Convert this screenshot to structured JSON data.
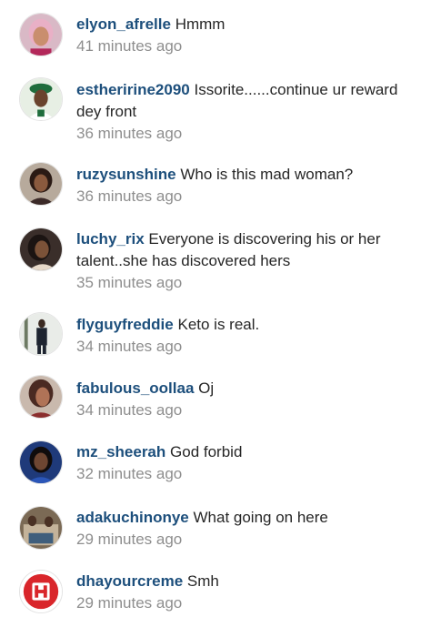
{
  "comments": [
    {
      "username": "elyon_afrelle",
      "text": "Hmmm",
      "time": "41 minutes ago",
      "avatar_icon": "avatar-woman-pink-hair-icon"
    },
    {
      "username": "estheririne2090",
      "text": "Issorite......continue ur reward dey front",
      "time": "36 minutes ago",
      "avatar_icon": "avatar-woman-cap-icon"
    },
    {
      "username": "ruzysunshine",
      "text": "Who is this mad woman?",
      "time": "36 minutes ago",
      "avatar_icon": "avatar-woman-icon"
    },
    {
      "username": "luchy_rix",
      "text": "Everyone is discovering his or her talent..she has discovered hers",
      "time": "35 minutes ago",
      "avatar_icon": "avatar-woman-icon"
    },
    {
      "username": "flyguyfreddie",
      "text": "Keto is real.",
      "time": "34 minutes ago",
      "avatar_icon": "avatar-man-suit-icon"
    },
    {
      "username": "fabulous_oollaa",
      "text": "Oj",
      "time": "34 minutes ago",
      "avatar_icon": "avatar-woman-icon"
    },
    {
      "username": "mz_sheerah",
      "text": "God forbid",
      "time": "32 minutes ago",
      "avatar_icon": "avatar-woman-blue-icon"
    },
    {
      "username": "adakuchinonye",
      "text": "What going on here",
      "time": "29 minutes ago",
      "avatar_icon": "avatar-group-icon"
    },
    {
      "username": "dhayourcreme",
      "text": "Smh",
      "time": "29 minutes ago",
      "avatar_icon": "avatar-logo-red-icon"
    }
  ]
}
